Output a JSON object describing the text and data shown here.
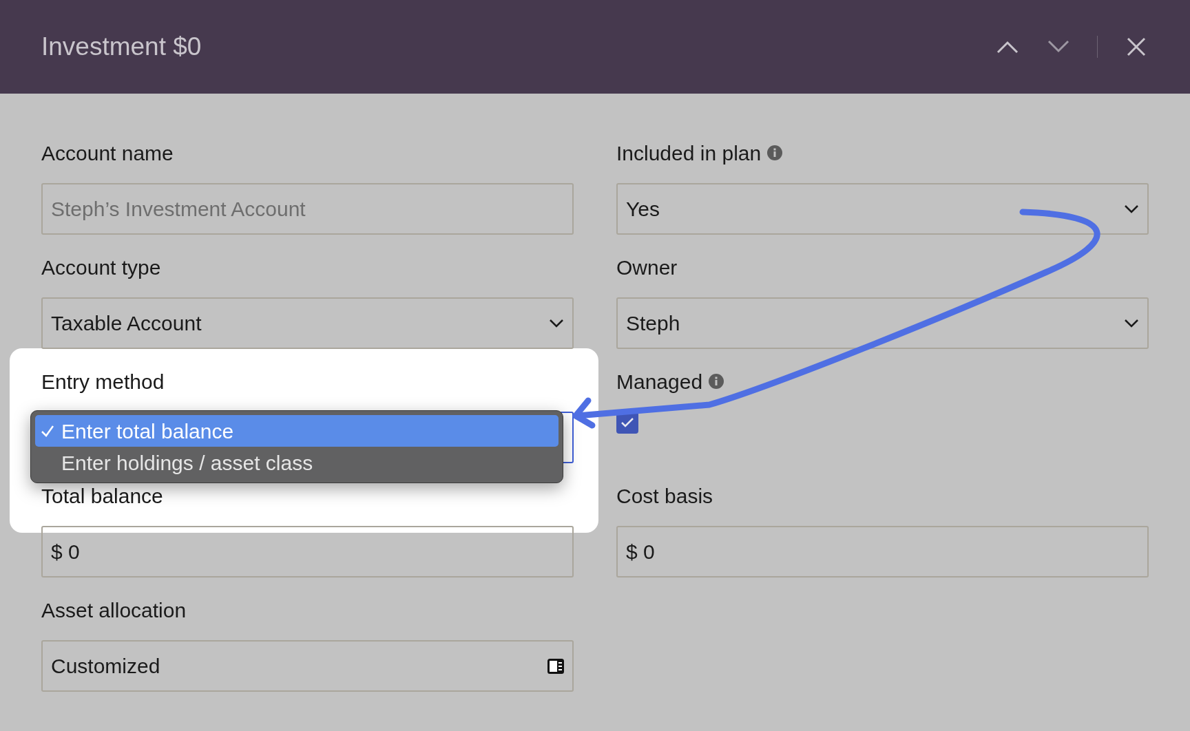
{
  "header": {
    "title": "Investment $0"
  },
  "fields": [
    {
      "kind": "text",
      "label": "Account name",
      "placeholder": "Steph’s Investment Account"
    },
    {
      "kind": "select",
      "label": "Included in plan",
      "value": "Yes",
      "info": true
    },
    {
      "kind": "select",
      "label": "Account type",
      "value": "Taxable Account"
    },
    {
      "kind": "select",
      "label": "Owner",
      "value": "Steph"
    },
    {
      "kind": "menu",
      "label": "Entry method",
      "highlighted": true,
      "options": [
        {
          "label": "Enter total balance",
          "selected": true
        },
        {
          "label": "Enter holdings / asset class",
          "selected": false
        }
      ]
    },
    {
      "kind": "checkbox",
      "label": "Managed",
      "checked": true,
      "info": true
    },
    {
      "kind": "text",
      "label": "Total balance",
      "value": "$ 0"
    },
    {
      "kind": "text",
      "label": "Cost basis",
      "value": "$ 0"
    },
    {
      "kind": "picker",
      "label": "Asset allocation",
      "value": "Customized"
    }
  ]
}
